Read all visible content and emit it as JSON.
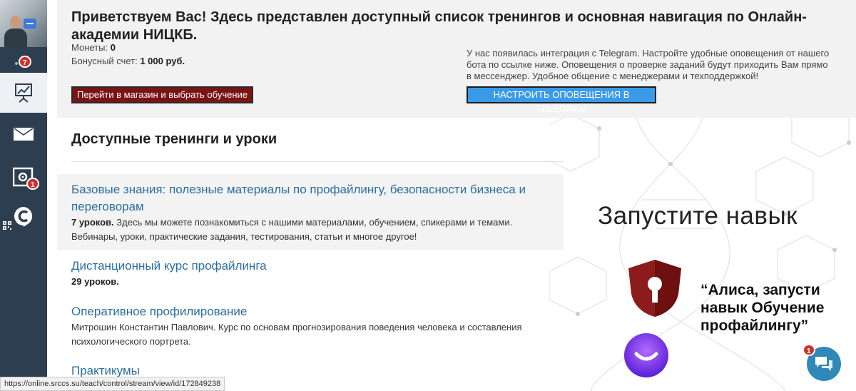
{
  "sidebar": {
    "notification_badge": "7",
    "items": [
      {
        "name": "stats",
        "icon": "chart-icon",
        "active": true
      },
      {
        "name": "messages",
        "icon": "mail-icon"
      },
      {
        "name": "settings",
        "icon": "settings-icon",
        "badge": "1"
      },
      {
        "name": "chat",
        "icon": "chat-logo-icon"
      }
    ]
  },
  "header": {
    "greeting": "Приветствуем Вас! Здесь представлен доступный список тренингов и основная навигация по Онлайн-академии НИЦКБ.",
    "coins_label": "Монеты:",
    "coins_value": "0",
    "bonus_label": "Бонусный счет:",
    "bonus_value": "1 000 руб.",
    "shop_button": "Перейти в магазин и выбрать обучение",
    "telegram_text": "У нас появилась интеграция с Telegram. Настройте удобные оповещения от нашего бота по ссылке ниже. Оповещения о проверке заданий будут приходить Вам прямо в мессенджер. Удобное общение с менеджерами и техподдержкой!",
    "telegram_button": "НАСТРОИТЬ ОПОВЕЩЕНИЯ В TELEGRAM"
  },
  "trainings_section": {
    "title": "Доступные тренинги и уроки",
    "items": [
      {
        "title": "Базовые знания: полезные материалы по профайлингу, безопасности бизнеса и переговорам",
        "lessons": "7 уроков.",
        "description": "Здесь мы можете познакомиться с нашими материалами, обучением, спикерами и темами. Вебинары, уроки, практические задания, тестирования, статьи и многое другое!"
      },
      {
        "title": "Дистанционный курс профайлинга",
        "lessons": "29 уроков.",
        "description": ""
      },
      {
        "title": "Оперативное профилирование",
        "lessons": "",
        "description": "Митрошин Константин Павлович. Курс по основам прогнозирования поведения человека и составления психологического портрета."
      },
      {
        "title": "Практикумы",
        "lessons": "",
        "description": ""
      }
    ]
  },
  "promo": {
    "heading": "Запустите навык",
    "quote": "“Алиса, запусти навык Обучение профайлингу”"
  },
  "status_bar": {
    "url": "https://online.srccs.su/teach/control/stream/view/id/172849238"
  },
  "chat_widget": {
    "badge": "1"
  },
  "colors": {
    "sidebar": "#2d3e50",
    "shop_button": "#7a1414",
    "telegram_button": "#3a9ae8",
    "link": "#2b6ea3",
    "badge": "#d0312d"
  }
}
